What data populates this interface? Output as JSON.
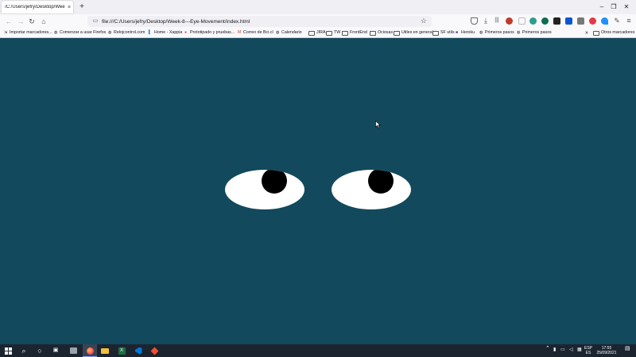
{
  "browser": {
    "tab_title": "/C:/Users/jefry/Desktop/Week-8---",
    "tab_close": "×",
    "new_tab": "+",
    "window_controls": [
      "–",
      "❐",
      "✕"
    ],
    "url": "file:///C:/Users/jefry/Desktop/Week-8---Eye-Movement/index.html",
    "bookmarks": [
      {
        "label": "Importar marcadores...",
        "icon": "import-icon"
      },
      {
        "label": "Comenzar a usar Firefox",
        "icon": "globe-icon"
      },
      {
        "label": "Relojcontrol.com",
        "icon": "globe-icon"
      },
      {
        "label": "Home - Xappia",
        "icon": "page-icon"
      },
      {
        "label": "Prototipado y pruebas...",
        "icon": "page-icon"
      },
      {
        "label": "Correo de Bci.cl",
        "icon": "mail-icon"
      },
      {
        "label": "Calendario",
        "icon": "globe-icon"
      },
      {
        "label": "JIRA",
        "icon": "folder-icon"
      },
      {
        "label": "TW",
        "icon": "folder-icon"
      },
      {
        "label": "FrontEnd",
        "icon": "folder-icon"
      },
      {
        "label": "Ociosas",
        "icon": "folder-icon"
      },
      {
        "label": "Utiles en general",
        "icon": "folder-icon"
      },
      {
        "label": "SF utils",
        "icon": "folder-icon"
      },
      {
        "label": "Heroku",
        "icon": "page-icon"
      },
      {
        "label": "Primeros pasos",
        "icon": "globe-icon"
      },
      {
        "label": "Primeros pasos",
        "icon": "globe-icon"
      }
    ],
    "bookmarks_overflow": "»",
    "other_bookmarks": "Otros marcadores"
  },
  "page": {
    "background": "#13495c",
    "eye_color": "#ffffff",
    "pupil_color": "#000000"
  },
  "taskbar": {
    "language": "ESP",
    "region": "ES",
    "time": "17:55",
    "date": "25/09/2021"
  }
}
